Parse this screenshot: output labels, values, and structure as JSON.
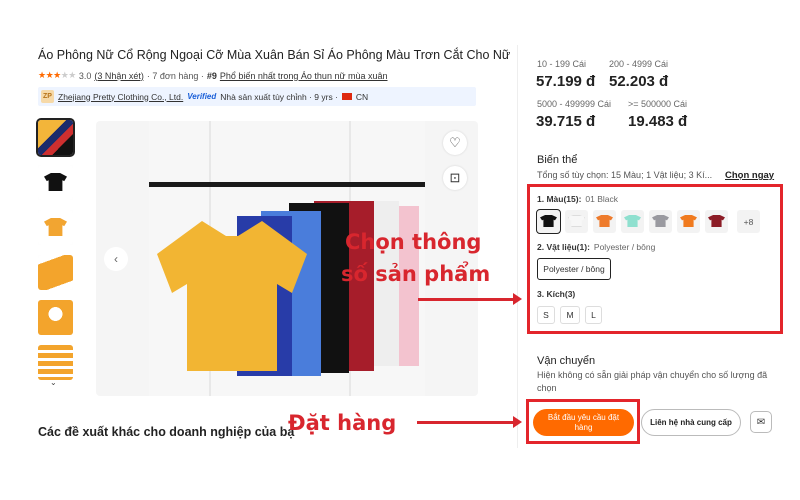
{
  "product": {
    "title": "Áo Phông Nữ Cổ Rộng Ngoại Cỡ Mùa Xuân Bán Sỉ Áo Phông Màu Trơn Cắt Cho Nữ",
    "rating": "3.0",
    "rating_stars": 3,
    "reviews": "(3 Nhận xét)",
    "orders": "· 7 đơn hàng ·",
    "rank": "#9",
    "rank_category": "Phổ biến nhất trong Áo thun nữ mùa xuân",
    "separator": "·"
  },
  "supplier": {
    "logo": "ZP",
    "name": "Zhejiang Pretty Clothing Co., Ltd.",
    "verified": "Verified",
    "type": "Nhà sản xuất tùy chỉnh · 9 yrs ·",
    "country": "CN"
  },
  "gallery": {
    "heart_icon": "heart-icon",
    "zoom_icon": "image-search-icon",
    "prev_icon": "‹",
    "down_icon": "⌄"
  },
  "suggest": {
    "heading": "Các đề xuất khác cho doanh nghiệp của bạ"
  },
  "pricing": {
    "tiers": [
      {
        "range": "10 - 199 Cái",
        "price": "57.199 đ"
      },
      {
        "range": "200 - 4999 Cái",
        "price": "52.203 đ"
      },
      {
        "range": "5000 - 499999 Cái",
        "price": "39.715 đ"
      },
      {
        "range": ">= 500000 Cái",
        "price": "19.483 đ"
      }
    ]
  },
  "variants": {
    "title": "Biến thể",
    "summary": "Tổng số tùy chọn: 15 Màu; 1 Vật liệu; 3 Kí...",
    "choose_now": "Chọn ngay",
    "color_label": "1. Màu(15):",
    "color_selected": "01 Black",
    "colors": [
      "#111111",
      "#f2f2f2",
      "#ee7b2c",
      "#8fe0cf",
      "#9a9aa0",
      "#f07a1e",
      "#8c1c26"
    ],
    "more_colors": "+8",
    "material_label": "2. Vật liệu(1):",
    "material_selected": "Polyester / bông",
    "material_option": "Polyester / bông",
    "size_label": "3. Kích(3)",
    "sizes": [
      "S",
      "M",
      "L"
    ]
  },
  "shipping": {
    "title": "Vận chuyển",
    "text": "Hiện không có sẵn giải pháp vận chuyển cho số lượng đã chọn"
  },
  "actions": {
    "order_label": "Bắt đầu yêu cầu đặt hàng",
    "contact_label": "Liên hệ nhà cung cấp",
    "chat_icon": "chat-icon"
  },
  "annotations": {
    "choose_specs_line1": "Chọn thông",
    "choose_specs_line2": "số sản phẩm",
    "place_order": "Đặt hàng",
    "color": "#d8262e"
  }
}
